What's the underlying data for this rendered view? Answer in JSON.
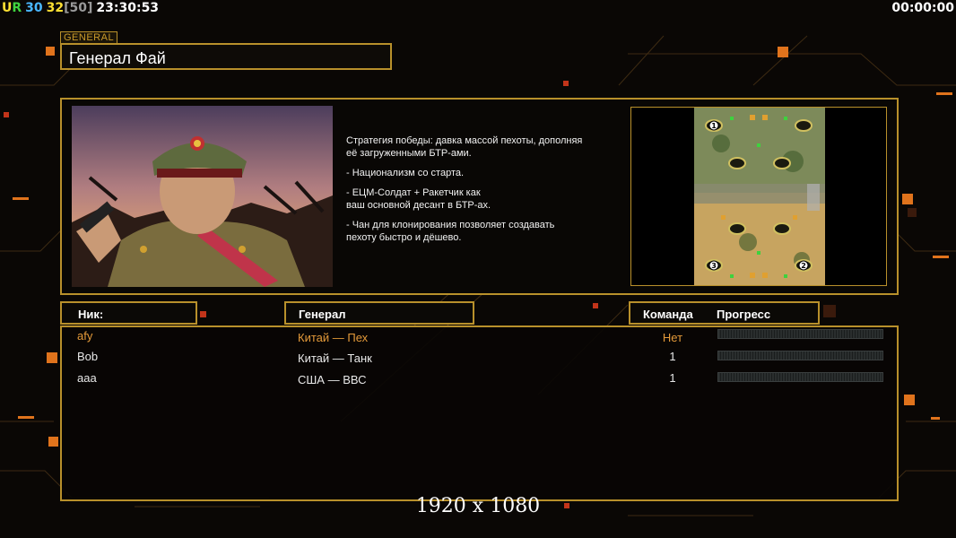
{
  "hud": {
    "ur_u": "U",
    "ur_r": "R",
    "val1": "30",
    "val2": "32",
    "val3": "[50]",
    "clock": "23:30:53",
    "timer": "00:00:00"
  },
  "general": {
    "tag": "GENERAL",
    "name": "Генерал Фай"
  },
  "strategy": {
    "line1": "Стратегия победы: давка массой пехоты, дополняя",
    "line2": " её загруженными БТР-ами.",
    "line3": "- Национализм со старта.",
    "line4": "- ЕЦМ-Солдат + Ракетчик как",
    "line5": "ваш основной десант в БТР-ах.",
    "line6": "- Чан для клонирования позволяет создавать",
    "line7": " пехоту быстро и дёшево."
  },
  "minimap": {
    "spots": [
      "1",
      "3",
      "2"
    ]
  },
  "headers": {
    "nick": "Ник:",
    "general": "Генерал",
    "team": "Команда",
    "progress": "Прогресс"
  },
  "players": [
    {
      "nick": "afy",
      "general": "Китай — Пех",
      "team": "Нет",
      "progress": 0
    },
    {
      "nick": "Bob",
      "general": "Китай — Танк",
      "team": "1",
      "progress": 0
    },
    {
      "nick": "aaa",
      "general": "США — ВВС",
      "team": "1",
      "progress": 0
    }
  ],
  "footer": {
    "resolution": "1920 x 1080"
  },
  "colors": {
    "gold": "#b8902b",
    "highlight": "#e49a3a",
    "accent_orange": "#ff6a00"
  }
}
